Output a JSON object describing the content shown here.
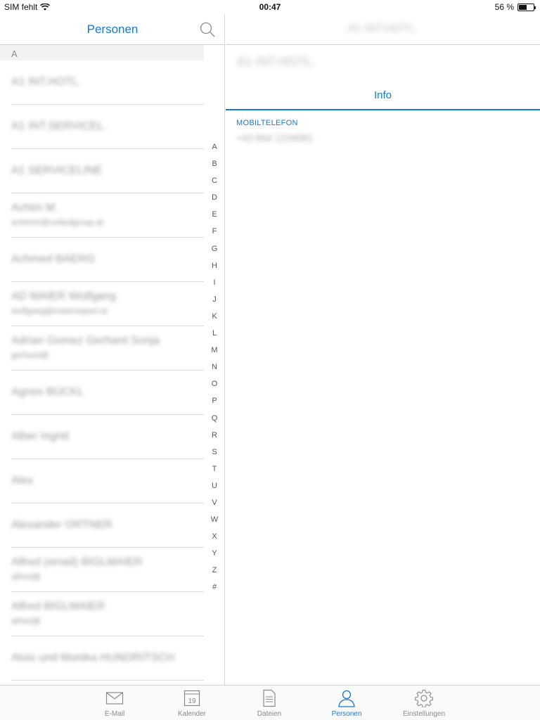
{
  "status_bar": {
    "carrier": "SIM fehlt",
    "time": "00:47",
    "battery_text": "56 %",
    "battery_level": 0.56
  },
  "list_pane": {
    "title": "Personen",
    "section_letter": "A",
    "contacts": [
      {
        "name": "A1 INT.HOTL."
      },
      {
        "name": "A1 INT.SERVICEL."
      },
      {
        "name": "A1 SERVICELINE"
      },
      {
        "name": "Achim M.",
        "sub": "achimm@unitedgroup.at"
      },
      {
        "name": "Achmed BAERG"
      },
      {
        "name": "AD MAIER Wolfgang",
        "sub": "wolfgang@maierexport.at"
      },
      {
        "name": "Adrian Gomez Gerhard Sonja",
        "sub": "gerhard@"
      },
      {
        "name": "Agnes BÜCKL"
      },
      {
        "name": "Alber Ingrid"
      },
      {
        "name": "Alex"
      },
      {
        "name": "Alexander ORTNER"
      },
      {
        "name": "Alfred (email) BIGLMAIER",
        "sub": "alfred@"
      },
      {
        "name": "Alfred BIGLMAIER",
        "sub": "alfred@"
      },
      {
        "name": "Alois und Monika HUNDRITSCH"
      }
    ],
    "index_letters": [
      "A",
      "B",
      "C",
      "D",
      "E",
      "F",
      "G",
      "H",
      "I",
      "J",
      "K",
      "L",
      "M",
      "N",
      "O",
      "P",
      "Q",
      "R",
      "S",
      "T",
      "U",
      "V",
      "W",
      "X",
      "Y",
      "Z",
      "#"
    ]
  },
  "detail_pane": {
    "header_title": "A1 INT.HOTL.",
    "name": "A1 INT.HOTL.",
    "tab_label": "Info",
    "field_label": "MOBILTELEFON",
    "field_value": "+43 664 1234561"
  },
  "tab_bar": {
    "items": [
      {
        "label": "E-Mail",
        "icon": "mail-icon"
      },
      {
        "label": "Kalender",
        "icon": "calendar-icon",
        "calendar_day": "19"
      },
      {
        "label": "Dateien",
        "icon": "document-icon"
      },
      {
        "label": "Personen",
        "icon": "person-icon",
        "active": true
      },
      {
        "label": "Einstellungen",
        "icon": "gear-icon"
      }
    ]
  },
  "colors": {
    "accent": "#1378d2"
  }
}
